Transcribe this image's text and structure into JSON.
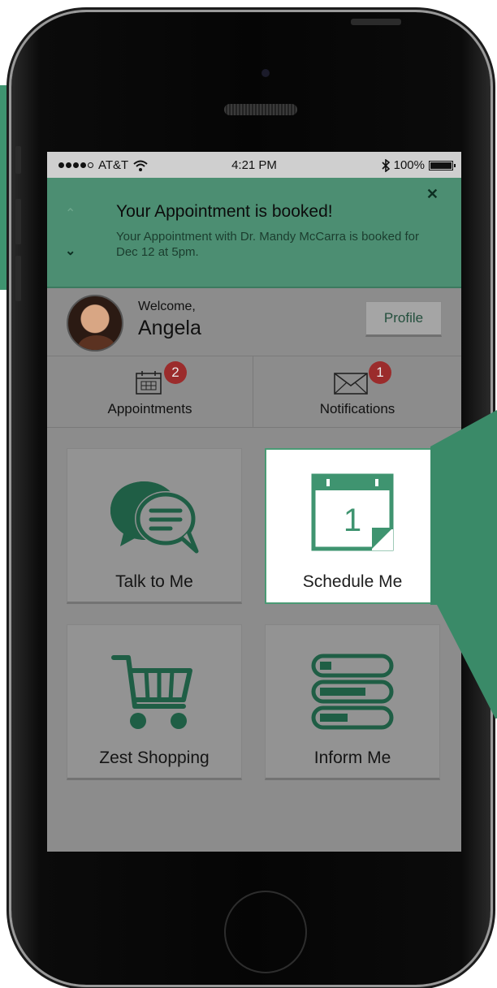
{
  "status_bar": {
    "carrier": "AT&T",
    "time": "4:21 PM",
    "battery": "100%",
    "icons": [
      "signal-dots-icon",
      "wifi-icon",
      "bluetooth-icon",
      "battery-icon"
    ]
  },
  "banner": {
    "title": "Your Appointment is booked!",
    "message": "Your Appointment with Dr. Mandy McCarra is booked for Dec 12 at 5pm.",
    "icons": [
      "chevron-up-icon",
      "chevron-down-icon",
      "close-icon"
    ]
  },
  "welcome": {
    "label": "Welcome,",
    "name": "Angela",
    "profile_button": "Profile"
  },
  "tabs": [
    {
      "label": "Appointments",
      "badge": "2",
      "icon": "calendar-icon"
    },
    {
      "label": "Notifications",
      "badge": "1",
      "icon": "envelope-icon"
    }
  ],
  "tiles": [
    {
      "label": "Talk to Me",
      "icon": "chat-bubbles-icon",
      "selected": false
    },
    {
      "label": "Schedule Me",
      "icon": "calendar-icon",
      "day": "1",
      "selected": true
    },
    {
      "label": "Zest Shopping",
      "icon": "shopping-cart-icon",
      "selected": false
    },
    {
      "label": "Inform Me",
      "icon": "progress-bars-icon",
      "selected": false
    }
  ],
  "colors": {
    "accent_green": "#3f9470",
    "banner_bg": "#4c8e72",
    "badge_red": "#9b2c2c",
    "screen_overlay": "#8c8c8c"
  }
}
